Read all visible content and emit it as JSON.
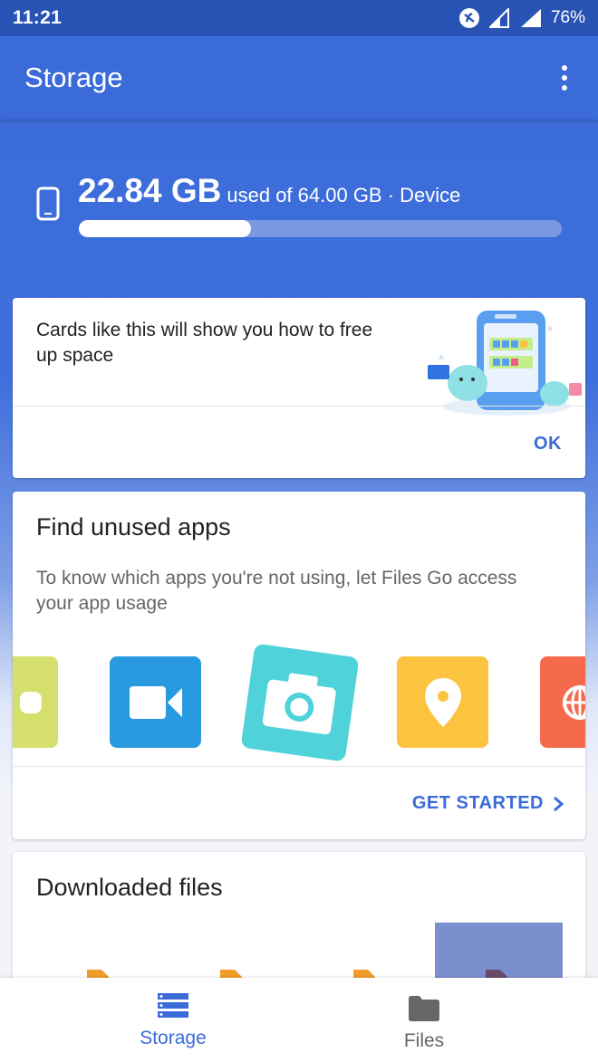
{
  "status_bar": {
    "time": "11:21",
    "battery": "76%"
  },
  "app_bar": {
    "title": "Storage",
    "menu_icon": "more-vert-icon"
  },
  "storage": {
    "used": "22.84 GB",
    "detail": "used of 64.00 GB · Device",
    "used_fraction": 0.357,
    "icon": "phone-icon"
  },
  "cards": {
    "tip": {
      "text": "Cards like this will show you how to free up space",
      "action": "OK"
    },
    "unused_apps": {
      "title": "Find unused apps",
      "description": "To know which apps you're not using, let Files Go access your app usage",
      "action": "GET STARTED",
      "tile_colors": [
        "#d4df6c",
        "#2a9ae0",
        "#4fd2d9",
        "#fbc33f",
        "#f56a4a"
      ]
    },
    "downloads": {
      "title": "Downloaded files"
    }
  },
  "bottom_nav": {
    "storage_label": "Storage",
    "files_label": "Files",
    "active_color": "#3a6bd9",
    "inactive_color": "#666666"
  }
}
